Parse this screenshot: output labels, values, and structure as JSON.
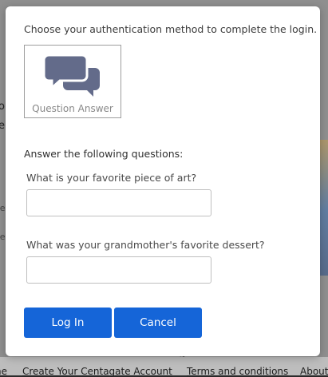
{
  "background": {
    "left_fragments": [
      "o",
      "e",
      "se",
      "se"
    ],
    "footer_partial": "g",
    "footer_links": [
      "ne",
      "Create Your Centagate Account",
      "Terms and conditions",
      "About"
    ]
  },
  "modal": {
    "intro": "Choose your authentication method to complete the login.",
    "method": {
      "icon": "chat-bubbles-icon",
      "label": "Question Answer"
    },
    "section_title": "Answer the following questions:",
    "questions": [
      {
        "label": "What is your favorite piece of art?",
        "value": ""
      },
      {
        "label": "What was your grandmother's favorite dessert?",
        "value": ""
      }
    ],
    "buttons": {
      "login": "Log In",
      "cancel": "Cancel"
    },
    "colors": {
      "primary": "#1565d8",
      "icon": "#636b8a"
    }
  }
}
